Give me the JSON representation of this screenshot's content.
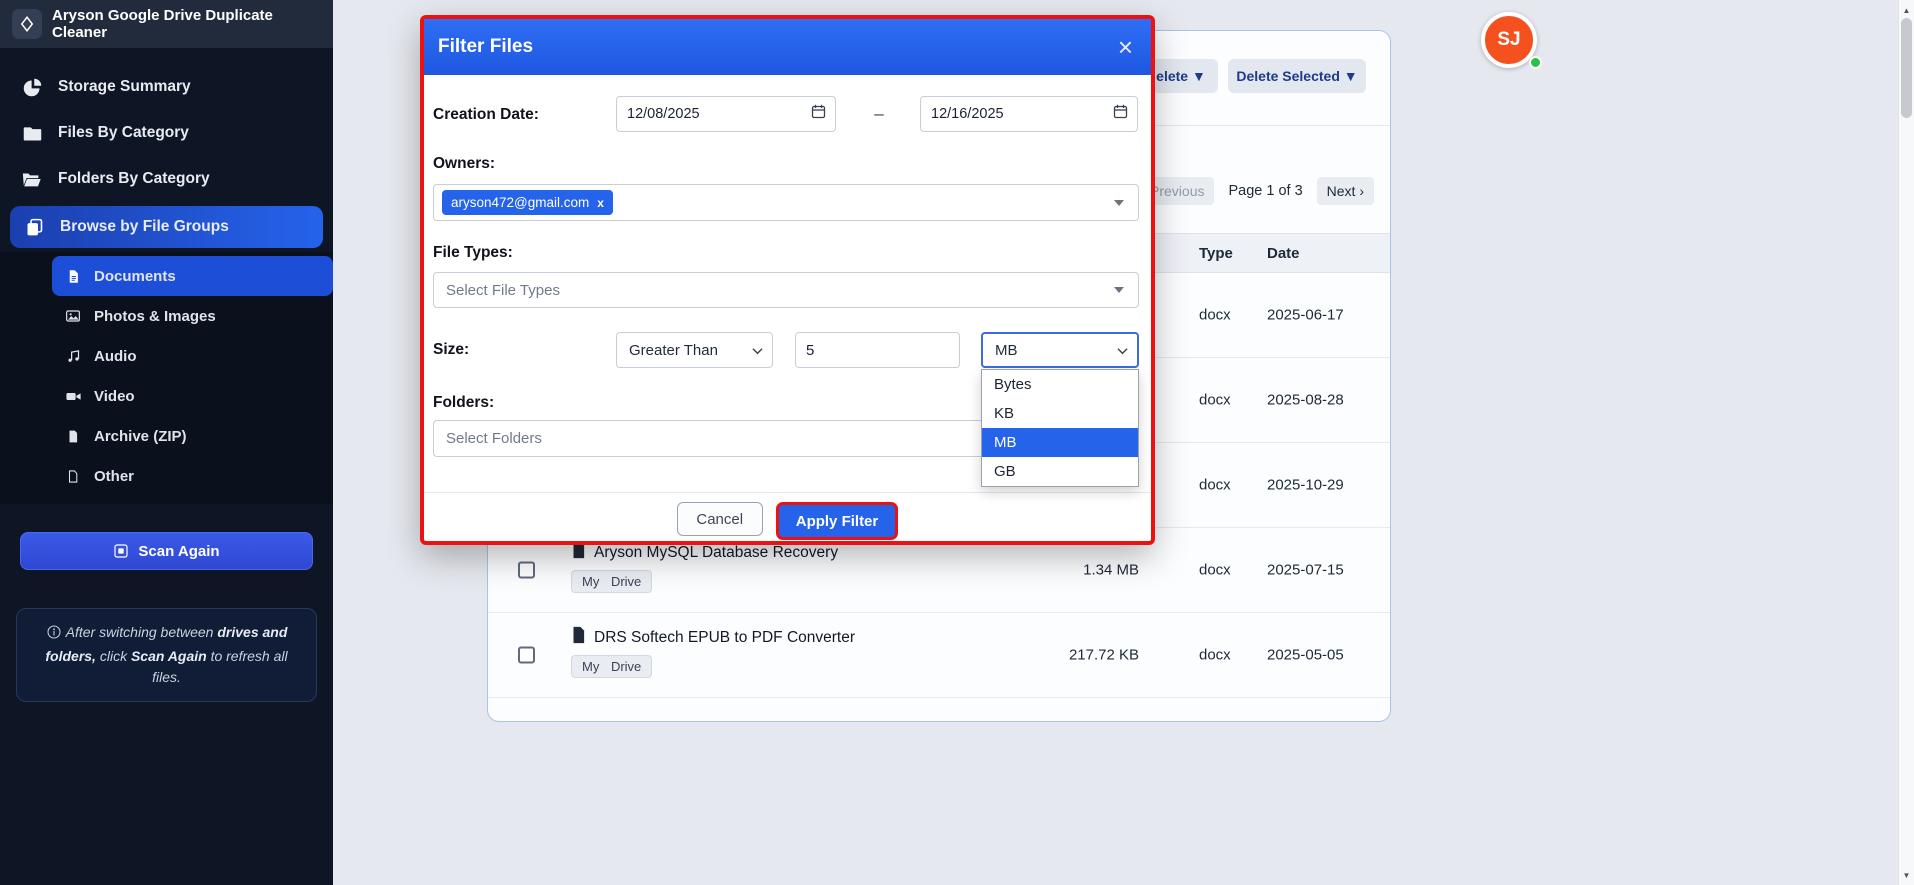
{
  "app": {
    "title": "Aryson Google Drive Duplicate Cleaner"
  },
  "sidebar": {
    "items": [
      {
        "label": "Storage Summary"
      },
      {
        "label": "Files By Category"
      },
      {
        "label": "Folders By Category"
      },
      {
        "label": "Browse by File Groups"
      }
    ],
    "subitems": [
      {
        "label": "Documents"
      },
      {
        "label": "Photos & Images"
      },
      {
        "label": "Audio"
      },
      {
        "label": "Video"
      },
      {
        "label": "Archive (ZIP)"
      },
      {
        "label": "Other"
      }
    ],
    "scan_button": "Scan Again",
    "note": {
      "part1": "After switching between ",
      "bold1": "drives and folders,",
      "part2": " click ",
      "bold2": "Scan Again",
      "part3": " to refresh all files."
    }
  },
  "header": {
    "avatar_initials": "SJ"
  },
  "toolbar": {
    "partial_delete_label": "elete ▼",
    "delete_selected_label": "Delete Selected ▼"
  },
  "pagination": {
    "fragment": ")",
    "previous": "‹ Previous",
    "page_info": "Page 1 of 3",
    "next": "Next ›"
  },
  "table": {
    "headers": {
      "type": "Type",
      "date": "Date"
    },
    "rows": [
      {
        "name": "",
        "location": "",
        "size": "",
        "type": "docx",
        "date": "2025-06-17"
      },
      {
        "name": "",
        "location": "",
        "size": "",
        "type": "docx",
        "date": "2025-08-28"
      },
      {
        "name": "",
        "location": "",
        "size": "",
        "type": "docx",
        "date": "2025-10-29"
      },
      {
        "name": "Aryson MySQL Database Recovery",
        "location": "My Drive",
        "size": "1.34 MB",
        "type": "docx",
        "date": "2025-07-15"
      },
      {
        "name": "DRS Softech EPUB to PDF Converter",
        "location": "My Drive",
        "size": "217.72 KB",
        "type": "docx",
        "date": "2025-05-05"
      }
    ]
  },
  "modal": {
    "title": "Filter Files",
    "close": "×",
    "creation_date": {
      "label": "Creation Date:",
      "from": "12/08/2025",
      "separator": "–",
      "to": "12/16/2025"
    },
    "owners": {
      "label": "Owners:",
      "chip": "aryson472@gmail.com",
      "chip_remove": "x"
    },
    "file_types": {
      "label": "File Types:",
      "placeholder": "Select File Types"
    },
    "size": {
      "label": "Size:",
      "operator": "Greater Than",
      "value": "5",
      "unit": "MB",
      "unit_options": [
        "Bytes",
        "KB",
        "MB",
        "GB"
      ]
    },
    "folders": {
      "label": "Folders:",
      "placeholder": "Select Folders"
    },
    "cancel_label": "Cancel",
    "apply_label": "Apply Filter"
  },
  "colors": {
    "accent_blue": "#2563eb",
    "highlight_red": "#ee1111",
    "sidebar_bg": "#0e1524",
    "avatar_bg": "#f4511e",
    "status_green": "#26c444"
  }
}
